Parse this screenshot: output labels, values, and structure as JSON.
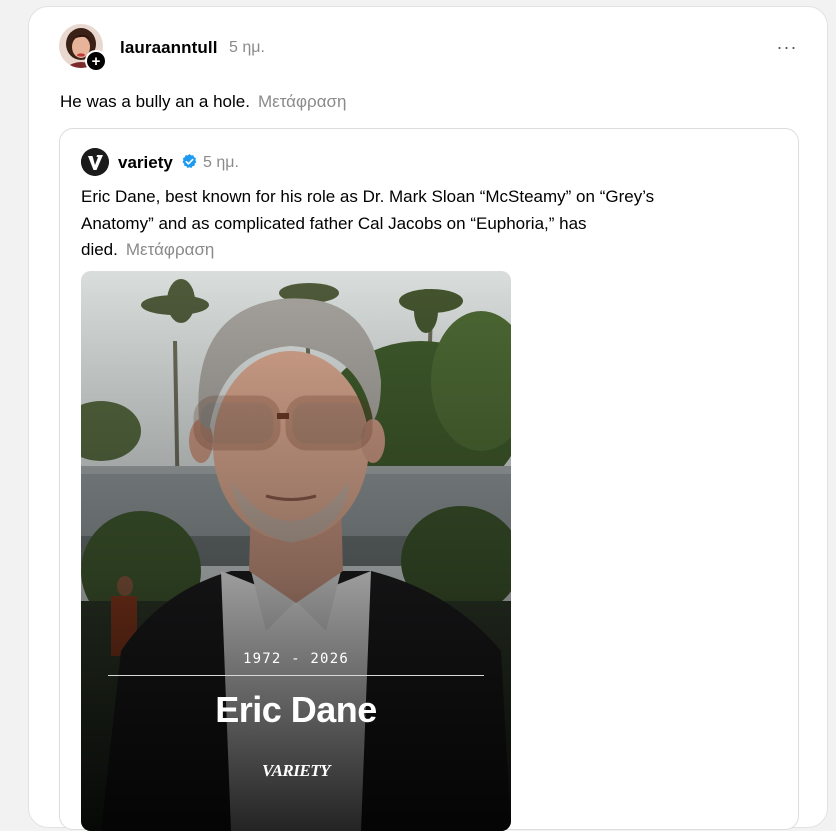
{
  "post": {
    "username": "lauraanntull",
    "time": "5 ημ.",
    "text": "He was a bully an a hole.",
    "translate_label": "Μετάφραση",
    "more_label": "···"
  },
  "quoted": {
    "username": "variety",
    "time": "5 ημ.",
    "verified_color": "#1d9bf0",
    "text": "Eric Dane, best known for his role as Dr. Mark Sloan “McSteamy” on “Grey’s Anatomy” and as complicated father Cal Jacobs on “Euphoria,” has died.",
    "translate_label": "Μετάφραση",
    "media": {
      "years": "1972 - 2026",
      "name": "Eric Dane",
      "brand": "VARIETY"
    }
  },
  "colors": {
    "secondary_text": "#8a8a8a",
    "card_border": "#e2e2e2"
  }
}
